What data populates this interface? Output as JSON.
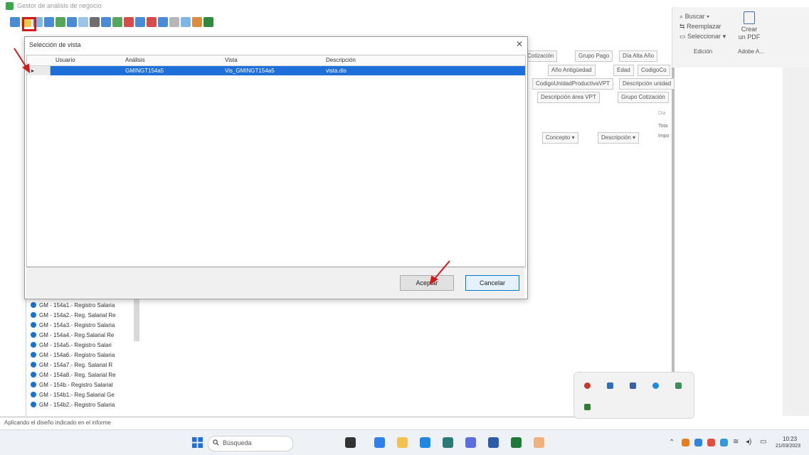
{
  "window": {
    "title": "Gestor de análisis de negocio"
  },
  "toolbar": {
    "icons": [
      "open-icon",
      "save-icon",
      "refresh-icon",
      "grid-icon",
      "export-icon",
      "filter-icon",
      "table-icon",
      "sum-icon",
      "chart-icon",
      "print-icon",
      "up-icon",
      "down-icon",
      "flag-icon",
      "line-chart-icon",
      "settings-icon",
      "tree-icon",
      "bar-chart-icon",
      "excel-icon"
    ]
  },
  "ribbon": {
    "buscar": "Buscar",
    "reemplazar": "Reemplazar",
    "seleccionar": "Seleccionar",
    "edicion": "Edición",
    "crear_pdf_line1": "Crear",
    "crear_pdf_line2": "un PDF",
    "adobe": "Adobe A..."
  },
  "background_fields": [
    "Cotización",
    "Grupo Pago",
    "Día Alta Año",
    "Año Antigüedad",
    "Edad",
    "CodigoCo",
    "CodigoUnidadProductivaVPT",
    "Descripción unidad",
    "Descripción área VPT",
    "Grupo Cotización",
    "Concepto",
    "Descripción",
    "Tota",
    "Impo",
    "Dia"
  ],
  "left_list": {
    "items": [
      "GM - 154a1.- Registro Salaria",
      "GM - 154a2.- Reg. Salarial Re",
      "GM - 154a3.- Registro Salaria",
      "GM - 154a4.- Reg.Salarial Re",
      "GM - 154a5.- Registro Salari",
      "GM - 154a6.- Registro Salaria",
      "GM - 154a7.- Reg. Salarial R",
      "GM - 154a8.- Reg. Salarial Re",
      "GM - 154b.- Registro Salarial",
      "GM - 154b1.- Reg.Salarial Ge",
      "GM - 154b2.- Registro Salaria"
    ]
  },
  "dialog": {
    "title": "Selección de vista",
    "close_glyph": "✕",
    "columns": [
      "Usuario",
      "Análisis",
      "Vista",
      "Descripción"
    ],
    "rows": [
      {
        "usuario": "",
        "analisis": "GMINGT154a5",
        "vista": "Vis_GMINGT154a5",
        "descripcion": "vista.dis"
      }
    ],
    "accept_label": "Aceptar",
    "cancel_label": "Cancelar"
  },
  "status": {
    "text": "Aplicando el diseño indicado en el informe"
  },
  "taskbar": {
    "search_placeholder": "Búsqueda",
    "time": "10:23",
    "date": "21/03/2023"
  },
  "colors": {
    "selection": "#1e6fd9",
    "highlight_box": "#d21a1a",
    "dot": "#1673d6"
  }
}
